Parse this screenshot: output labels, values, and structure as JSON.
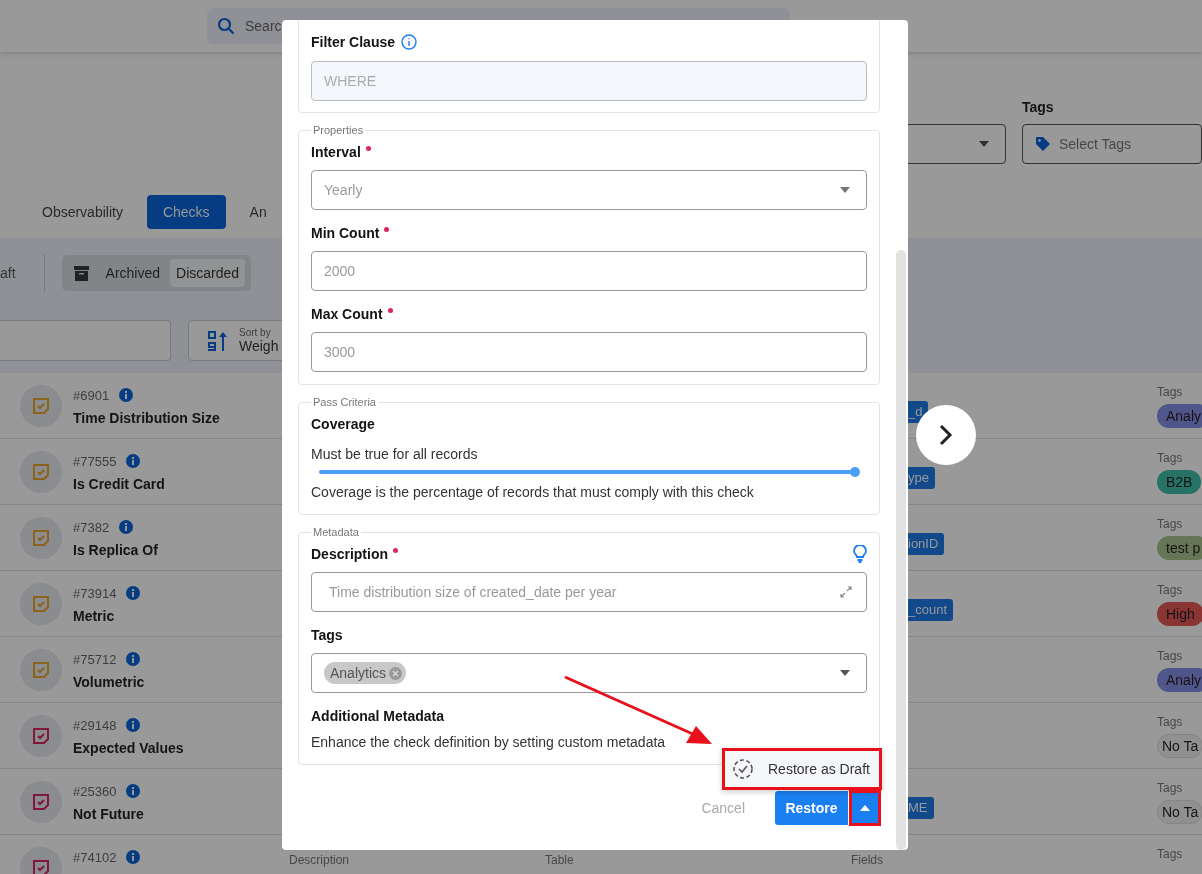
{
  "header": {
    "search": {
      "placeholder": "Searc"
    }
  },
  "filters": {
    "tags_label": "Tags",
    "tags_select": {
      "placeholder": "Select Tags"
    }
  },
  "tabs": [
    {
      "label": "Observability",
      "selected": false
    },
    {
      "label": "Checks",
      "selected": true
    },
    {
      "label": "An",
      "selected": false
    }
  ],
  "status_bar": {
    "left_text": "aft",
    "group_label": "Archived",
    "chips": [
      {
        "label": "Discarded"
      }
    ]
  },
  "sort": {
    "label": "Sort by",
    "value": "Weigh"
  },
  "checks": [
    {
      "id": "#6901",
      "name": "Time Distribution Size",
      "color": "#8b6319",
      "field": "_d",
      "tags_label": "Tags",
      "tag": {
        "kind": "filled",
        "label": "Analy",
        "color": "#50568a"
      }
    },
    {
      "id": "#77555",
      "name": "Is Credit Card",
      "color": "#8b6319",
      "field": "ype",
      "tags_label": "Tags",
      "tag": {
        "kind": "filled",
        "label": "B2B",
        "color": "#267366"
      }
    },
    {
      "id": "#7382",
      "name": "Is Replica Of",
      "color": "#8b6319",
      "field": "ionID",
      "tags_label": "Tags",
      "tag": {
        "kind": "filled",
        "label": "test p",
        "color": "#657656"
      }
    },
    {
      "id": "#73914",
      "name": "Metric",
      "color": "#8b6319",
      "field": "_count",
      "tags_label": "Tags",
      "tag": {
        "kind": "filled",
        "label": "High",
        "color": "#8b3434"
      }
    },
    {
      "id": "#75712",
      "name": "Volumetric",
      "color": "#8b6319",
      "tags_label": "Tags",
      "tag": {
        "kind": "filled",
        "label": "Analy",
        "color": "#50568a"
      }
    },
    {
      "id": "#29148",
      "name": "Expected Values",
      "color": "#811739",
      "tags_label": "Tags",
      "tag": {
        "kind": "outline",
        "label": "No Ta"
      }
    },
    {
      "id": "#25360",
      "name": "Not Future",
      "color": "#811739",
      "field": "ME",
      "tags_label": "Tags",
      "tag": {
        "kind": "outline",
        "label": "No Ta"
      }
    },
    {
      "id": "#74102",
      "color": "#811739",
      "description_label": "Description",
      "table_label": "Table",
      "fields_label": "Fields",
      "tags_label": "Tags"
    }
  ],
  "modal": {
    "filter_clause": {
      "label": "Filter Clause",
      "placeholder": "WHERE"
    },
    "properties": {
      "legend": "Properties",
      "fields": [
        {
          "label": "Interval",
          "required": true,
          "kind": "select",
          "value": "Yearly"
        },
        {
          "label": "Min Count",
          "required": true,
          "kind": "input",
          "value": "2000"
        },
        {
          "label": "Max Count",
          "required": true,
          "kind": "input",
          "value": "3000"
        }
      ]
    },
    "pass_criteria": {
      "legend": "Pass Criteria",
      "title": "Coverage",
      "rule": "Must be true for all records",
      "level": 1,
      "note": "Coverage is the percentage of records that must comply with this check"
    },
    "metadata": {
      "legend": "Metadata",
      "description": {
        "label": "Description",
        "required": true,
        "value": "Time distribution size of created_date per year"
      },
      "tags": {
        "label": "Tags",
        "chips": [
          "Analytics"
        ]
      },
      "additional": {
        "title": "Additional Metadata",
        "text": "Enhance the check definition by setting custom metadata"
      }
    },
    "menu": {
      "items": [
        {
          "label": "Restore as Draft"
        }
      ]
    },
    "buttons": {
      "cancel": "Cancel",
      "restore": "Restore"
    }
  }
}
